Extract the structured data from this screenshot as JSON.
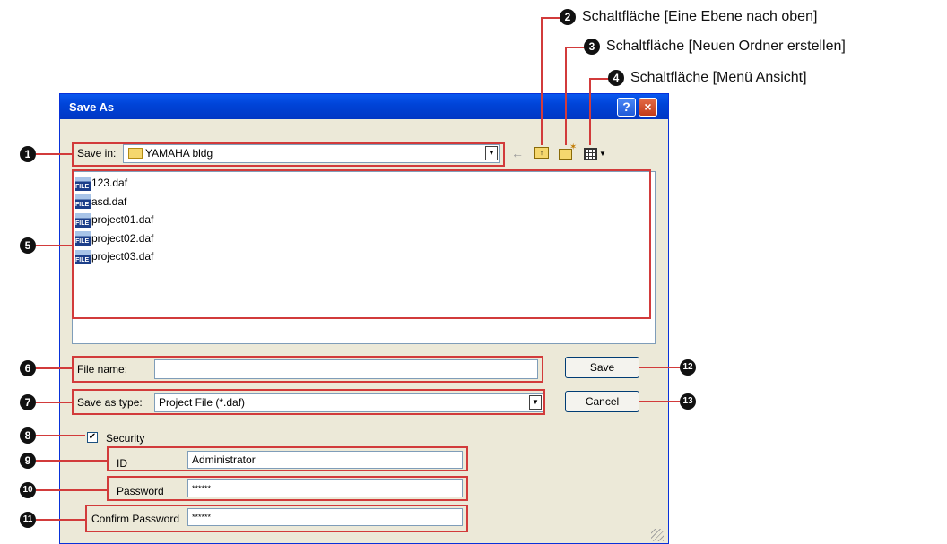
{
  "dialog": {
    "title": "Save As",
    "help_label": "?",
    "close_label": "×",
    "save_in_label": "Save in:",
    "save_in_value": "YAMAHA bldg",
    "files": [
      "123.daf",
      "asd.daf",
      "project01.daf",
      "project02.daf",
      "project03.daf"
    ],
    "file_icon_text": "FILE",
    "file_name_label": "File name:",
    "file_name_value": "",
    "save_as_type_label": "Save as type:",
    "save_as_type_value": "Project File (*.daf)",
    "security_label": "Security",
    "security_checked": true,
    "id_label": "ID",
    "id_value": "Administrator",
    "password_label": "Password",
    "password_value": "******",
    "confirm_label": "Confirm Password",
    "confirm_value": "******",
    "save_button": "Save",
    "cancel_button": "Cancel"
  },
  "annotations": {
    "n1": "1",
    "n2": "2",
    "n3": "3",
    "n4": "4",
    "n5": "5",
    "n6": "6",
    "n7": "7",
    "n8": "8",
    "n9": "9",
    "n10": "10",
    "n11": "11",
    "n12": "12",
    "n13": "13",
    "label2": "Schaltfläche [Eine Ebene nach oben]",
    "label3": "Schaltfläche [Neuen Ordner erstellen]",
    "label4": "Schaltfläche [Menü Ansicht]"
  },
  "colors": {
    "accent_red": "#d23b3b",
    "titlebar_blue": "#0044d8",
    "dialog_bg": "#ece9d8"
  }
}
